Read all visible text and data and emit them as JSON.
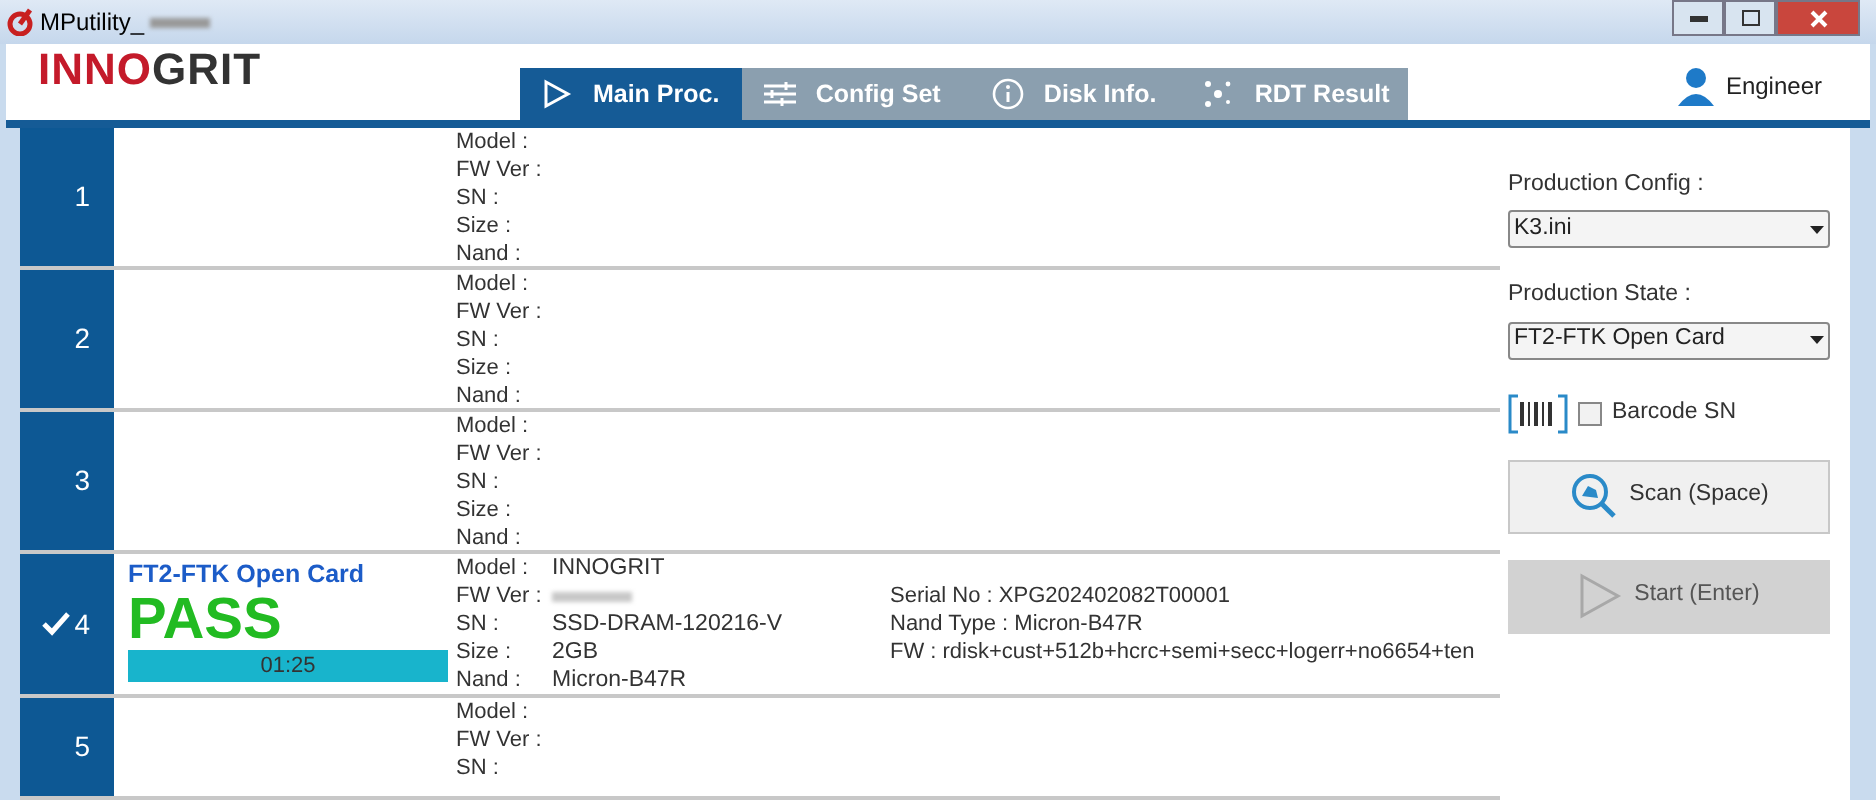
{
  "window": {
    "title": "MPutility_"
  },
  "logo": {
    "first": "INNO",
    "second": "GRIT"
  },
  "tabs": [
    {
      "label": "Main Proc.",
      "kind": "play",
      "selected": true
    },
    {
      "label": "Config Set",
      "kind": "sliders",
      "selected": false
    },
    {
      "label": "Disk Info.",
      "kind": "info",
      "selected": false
    },
    {
      "label": "RDT Result",
      "kind": "dots",
      "selected": false
    }
  ],
  "user": {
    "role": "Engineer"
  },
  "slots": [
    {
      "number": "1",
      "checked": false,
      "fields": [
        {
          "label": "Model :"
        },
        {
          "label": "FW Ver :"
        },
        {
          "label": "SN :"
        },
        {
          "label": "Size :"
        },
        {
          "label": "Nand :"
        }
      ]
    },
    {
      "number": "2",
      "checked": false,
      "fields": [
        {
          "label": "Model :"
        },
        {
          "label": "FW Ver :"
        },
        {
          "label": "SN :"
        },
        {
          "label": "Size :"
        },
        {
          "label": "Nand :"
        }
      ]
    },
    {
      "number": "3",
      "checked": false,
      "fields": [
        {
          "label": "Model :"
        },
        {
          "label": "FW Ver :"
        },
        {
          "label": "SN :"
        },
        {
          "label": "Size :"
        },
        {
          "label": "Nand :"
        }
      ]
    },
    {
      "number": "4",
      "checked": true,
      "status": {
        "stage": "FT2-FTK Open Card",
        "result": "PASS",
        "time": "01:25"
      },
      "fields": [
        {
          "label": "Model :",
          "value": "INNOGRIT"
        },
        {
          "label": "FW Ver :",
          "redacted": true
        },
        {
          "label": "SN :",
          "value": "SSD-DRAM-120216-V"
        },
        {
          "label": "Size :",
          "value": "2GB"
        },
        {
          "label": "Nand :",
          "value": "Micron-B47R"
        }
      ],
      "details": [
        "Serial No : XPG202402082T00001",
        "Nand Type : Micron-B47R",
        "FW : rdisk+cust+512b+hcrc+semi+secc+logerr+no6654+ten"
      ]
    },
    {
      "number": "5",
      "checked": false,
      "fields": [
        {
          "label": "Model :"
        },
        {
          "label": "FW Ver :"
        },
        {
          "label": "SN :"
        }
      ]
    }
  ],
  "panel": {
    "production_config": {
      "label": "Production Config :",
      "value": "K3.ini"
    },
    "production_state": {
      "label": "Production State :",
      "value": "FT2-FTK Open Card"
    },
    "barcode_sn": {
      "label": "Barcode SN",
      "checked": false
    },
    "buttons": [
      {
        "label": "Scan (Space)",
        "kind": "scan",
        "disabled": false
      },
      {
        "label": "Start (Enter)",
        "kind": "start",
        "disabled": true
      }
    ]
  }
}
